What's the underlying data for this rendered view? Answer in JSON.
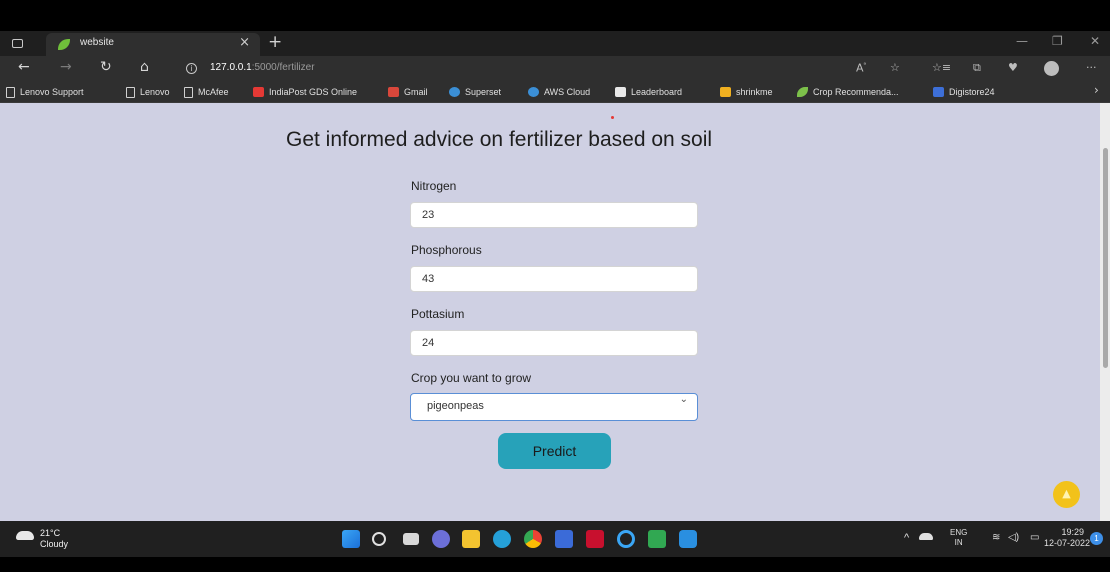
{
  "browser": {
    "tab_title": "website",
    "tab_close": "×",
    "new_tab": "+",
    "url_host": "127.0.0.1",
    "url_rest": ":5000/fertilizer",
    "bookmarks": [
      {
        "label": "Lenovo Support",
        "icon": "page-icon",
        "color": "#d0d0d0"
      },
      {
        "label": "Lenovo",
        "icon": "page-icon",
        "color": "#d0d0d0"
      },
      {
        "label": "McAfee",
        "icon": "page-icon",
        "color": "#d0d0d0"
      },
      {
        "label": "IndiaPost GDS Online",
        "icon": "indiapost-icon",
        "color": "#e53935"
      },
      {
        "label": "Gmail",
        "icon": "gmail-icon",
        "color": "#d9473b"
      },
      {
        "label": "Superset",
        "icon": "superset-icon",
        "color": "#3b8fd6"
      },
      {
        "label": "AWS Cloud",
        "icon": "aws-icon",
        "color": "#3b8fd6"
      },
      {
        "label": "Leaderboard",
        "icon": "leaderboard-icon",
        "color": "#e8e8e8"
      },
      {
        "label": "shrinkme",
        "icon": "shrinkme-icon",
        "color": "#f0b020"
      },
      {
        "label": "Crop Recommenda...",
        "icon": "leaf-icon",
        "color": "#7cc04a"
      },
      {
        "label": "Digistore24",
        "icon": "digistore-icon",
        "color": "#3d6fd8"
      }
    ]
  },
  "page": {
    "heading": "Get informed advice on fertilizer based on soil",
    "nitrogen_label": "Nitrogen",
    "nitrogen_value": "23",
    "phosphorous_label": "Phosphorous",
    "phosphorous_value": "43",
    "pottasium_label": "Pottasium",
    "pottasium_value": "24",
    "crop_label": "Crop you want to grow",
    "crop_selected": "pigeonpeas",
    "predict_label": "Predict"
  },
  "taskbar": {
    "temperature": "21°C",
    "weather": "Cloudy",
    "lang_top": "ENG",
    "lang_bottom": "IN",
    "time": "19:29",
    "date": "12-07-2022",
    "notification_count": "1"
  },
  "colors": {
    "page_background": "#cfd0e3",
    "predict_button": "#27a2b9",
    "scroll_top_button": "#f2c21a"
  }
}
